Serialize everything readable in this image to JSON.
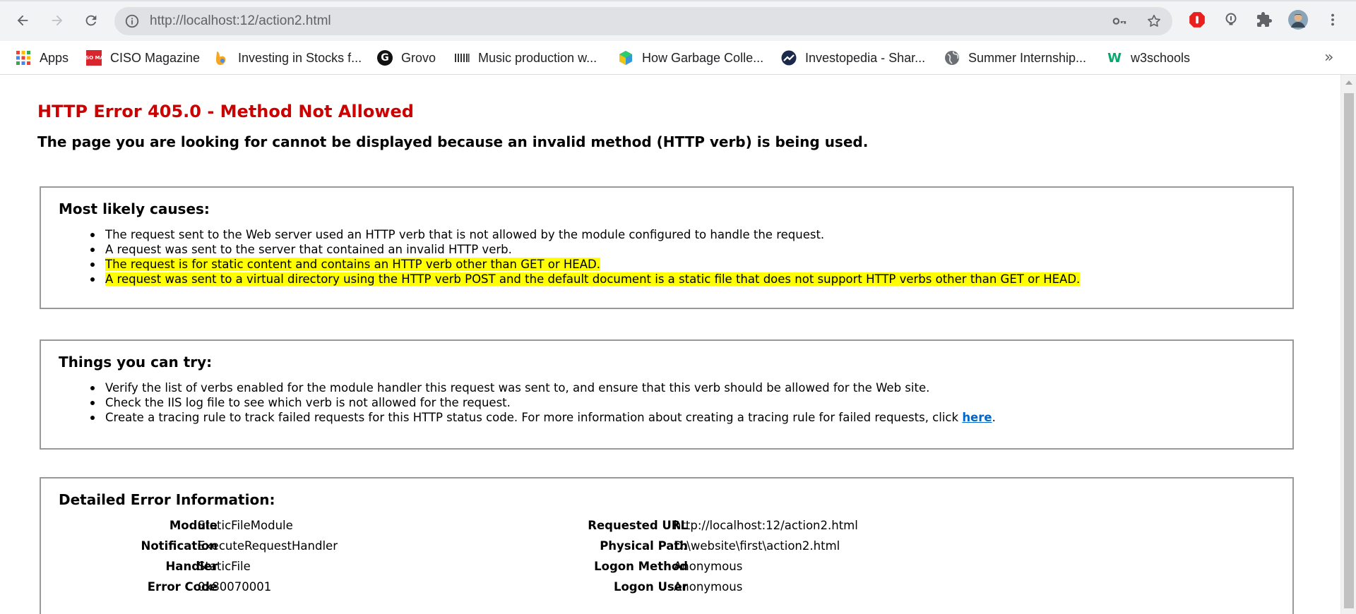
{
  "browser": {
    "url": "http://localhost:12/action2.html",
    "bookmarks": [
      {
        "label": "Apps",
        "icon": "apps-grid-icon"
      },
      {
        "label": "CISO Magazine",
        "icon": "ciso-mag-icon"
      },
      {
        "label": "Investing in Stocks f...",
        "icon": "investing-icon"
      },
      {
        "label": "Grovo",
        "icon": "grovo-icon"
      },
      {
        "label": "Music production w...",
        "icon": "music-icon"
      },
      {
        "label": "How Garbage Colle...",
        "icon": "cube-icon"
      },
      {
        "label": "Investopedia - Shar...",
        "icon": "investopedia-icon"
      },
      {
        "label": "Summer Internship...",
        "icon": "globe-icon"
      },
      {
        "label": "w3schools",
        "icon": "w3schools-icon"
      }
    ],
    "bookmarks_more": "»",
    "ciso_badge": "CISO MAG",
    "grovo_badge": "G",
    "w3_badge": "W"
  },
  "page": {
    "title": "HTTP Error 405.0 - Method Not Allowed",
    "subtitle": "The page you are looking for cannot be displayed because an invalid method (HTTP verb) is being used.",
    "causes": {
      "heading": "Most likely causes:",
      "items": [
        "The request sent to the Web server used an HTTP verb that is not allowed by the module configured to handle the request.",
        "A request was sent to the server that contained an invalid HTTP verb.",
        "The request is for static content and contains an HTTP verb other than GET or HEAD.",
        "A request was sent to a virtual directory using the HTTP verb POST and the default document is a static file that does not support HTTP verbs other than GET or HEAD."
      ]
    },
    "try": {
      "heading": "Things you can try:",
      "items": [
        "Verify the list of verbs enabled for the module handler this request was sent to, and ensure that this verb should be allowed for the Web site.",
        "Check the IIS log file to see which verb is not allowed for the request.",
        "Create a tracing rule to track failed requests for this HTTP status code. For more information about creating a tracing rule for failed requests, click "
      ],
      "link": "here",
      "after_link": "."
    },
    "details": {
      "heading": "Detailed Error Information:",
      "left": [
        {
          "label": "Module",
          "value": "StaticFileModule"
        },
        {
          "label": "Notification",
          "value": "ExecuteRequestHandler"
        },
        {
          "label": "Handler",
          "value": "StaticFile"
        },
        {
          "label": "Error Code",
          "value": "0x80070001"
        }
      ],
      "right": [
        {
          "label": "Requested URL",
          "value": "http://localhost:12/action2.html"
        },
        {
          "label": "Physical Path",
          "value": "D:\\website\\first\\action2.html"
        },
        {
          "label": "Logon Method",
          "value": "Anonymous"
        },
        {
          "label": "Logon User",
          "value": "Anonymous"
        }
      ]
    }
  },
  "colors": {
    "error_red": "#cc0000",
    "highlight": "#ffff00",
    "link": "#0066cc"
  }
}
